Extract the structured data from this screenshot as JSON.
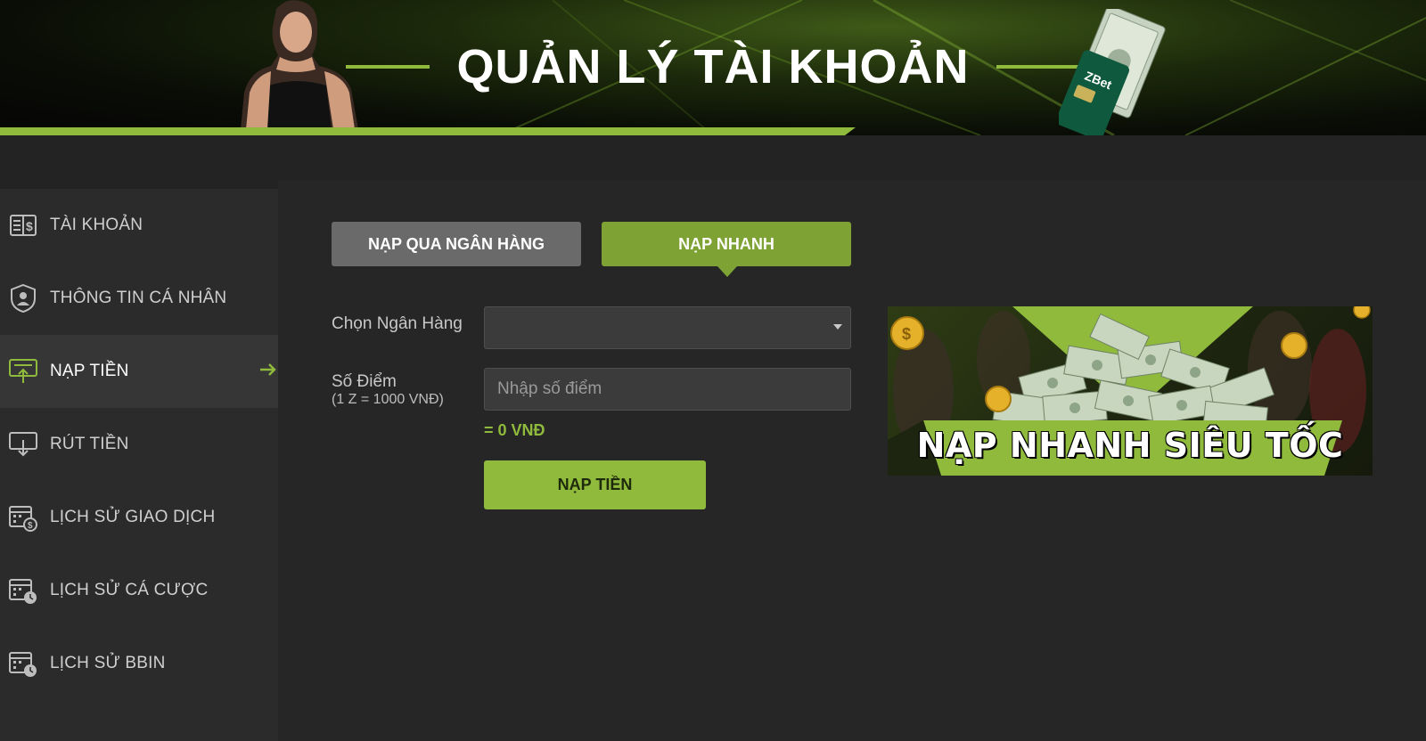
{
  "header": {
    "title": "QUẢN LÝ TÀI KHOẢN"
  },
  "sidebar": {
    "items": [
      {
        "label": "TÀI KHOẢN",
        "icon": "account-book-icon",
        "active": false
      },
      {
        "label": "THÔNG TIN CÁ NHÂN",
        "icon": "profile-shield-icon",
        "active": false
      },
      {
        "label": "NẠP TIỀN",
        "icon": "deposit-icon",
        "active": true
      },
      {
        "label": "RÚT TIỀN",
        "icon": "withdraw-icon",
        "active": false
      },
      {
        "label": "LỊCH SỬ GIAO DỊCH",
        "icon": "calendar-dollar-icon",
        "active": false
      },
      {
        "label": "LỊCH SỬ CÁ CƯỢC",
        "icon": "calendar-clock-icon",
        "active": false
      },
      {
        "label": "LỊCH SỬ BBIN",
        "icon": "calendar-clock-icon",
        "active": false
      }
    ],
    "active_arrow_icon": "arrow-right-icon"
  },
  "tabs": [
    {
      "label": "NẠP QUA NGÂN HÀNG",
      "active": false
    },
    {
      "label": "NẠP NHANH",
      "active": true
    }
  ],
  "form": {
    "bank_label": "Chọn Ngân Hàng",
    "bank_value": "",
    "points_label": "Số Điểm",
    "points_sublabel": "(1 Z = 1000 VNĐ)",
    "points_placeholder": "Nhập số điểm",
    "points_value": "",
    "conversion": "= 0 VNĐ",
    "submit_label": "NẠP TIỀN"
  },
  "promo": {
    "text": "NẠP NHANH SIÊU TỐC"
  },
  "colors": {
    "accent": "#8fba3c",
    "tab_active": "#7ea234",
    "tab_inactive": "#6a6a6a",
    "background": "#232323",
    "sidebar": "#2b2b2b"
  }
}
